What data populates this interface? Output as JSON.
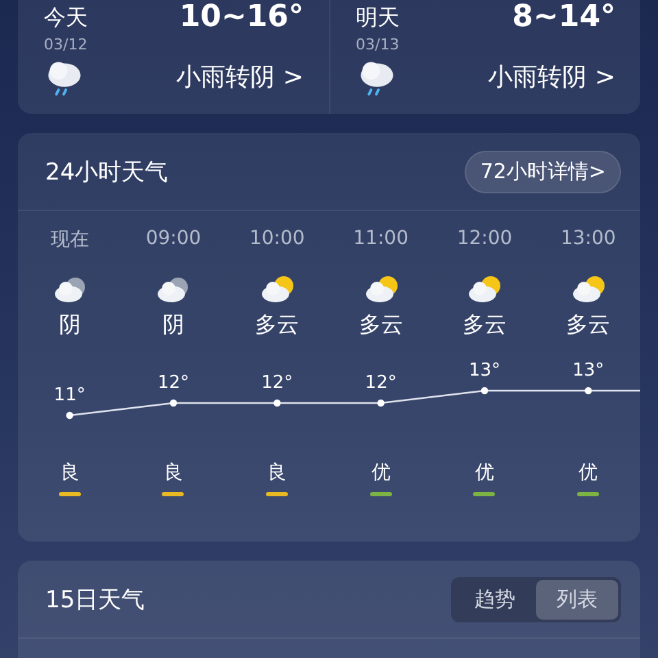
{
  "days": [
    {
      "label": "今天",
      "date": "03/12",
      "temp": "10~16°",
      "condition": "小雨转阴 >",
      "kind": "rain"
    },
    {
      "label": "明天",
      "date": "03/13",
      "temp": "8~14°",
      "condition": "小雨转阴 >",
      "kind": "rain"
    }
  ],
  "hourly": {
    "title": "24小时天气",
    "link": "72小时详情>",
    "hours": [
      {
        "time": "现在",
        "kind": "overcast",
        "condition": "阴",
        "temp": "11°",
        "quality": "良",
        "color": "#e8b923"
      },
      {
        "time": "09:00",
        "kind": "overcast",
        "condition": "阴",
        "temp": "12°",
        "quality": "良",
        "color": "#e8b923"
      },
      {
        "time": "10:00",
        "kind": "partly",
        "condition": "多云",
        "temp": "12°",
        "quality": "良",
        "color": "#e8b923"
      },
      {
        "time": "11:00",
        "kind": "partly",
        "condition": "多云",
        "temp": "12°",
        "quality": "优",
        "color": "#7cb342"
      },
      {
        "time": "12:00",
        "kind": "partly",
        "condition": "多云",
        "temp": "13°",
        "quality": "优",
        "color": "#7cb342"
      },
      {
        "time": "13:00",
        "kind": "partly",
        "condition": "多云",
        "temp": "13°",
        "quality": "优",
        "color": "#7cb342"
      }
    ]
  },
  "daily": {
    "title": "15日天气",
    "tabs": [
      {
        "label": "趋势",
        "selected": false
      },
      {
        "label": "列表",
        "selected": true
      }
    ]
  }
}
